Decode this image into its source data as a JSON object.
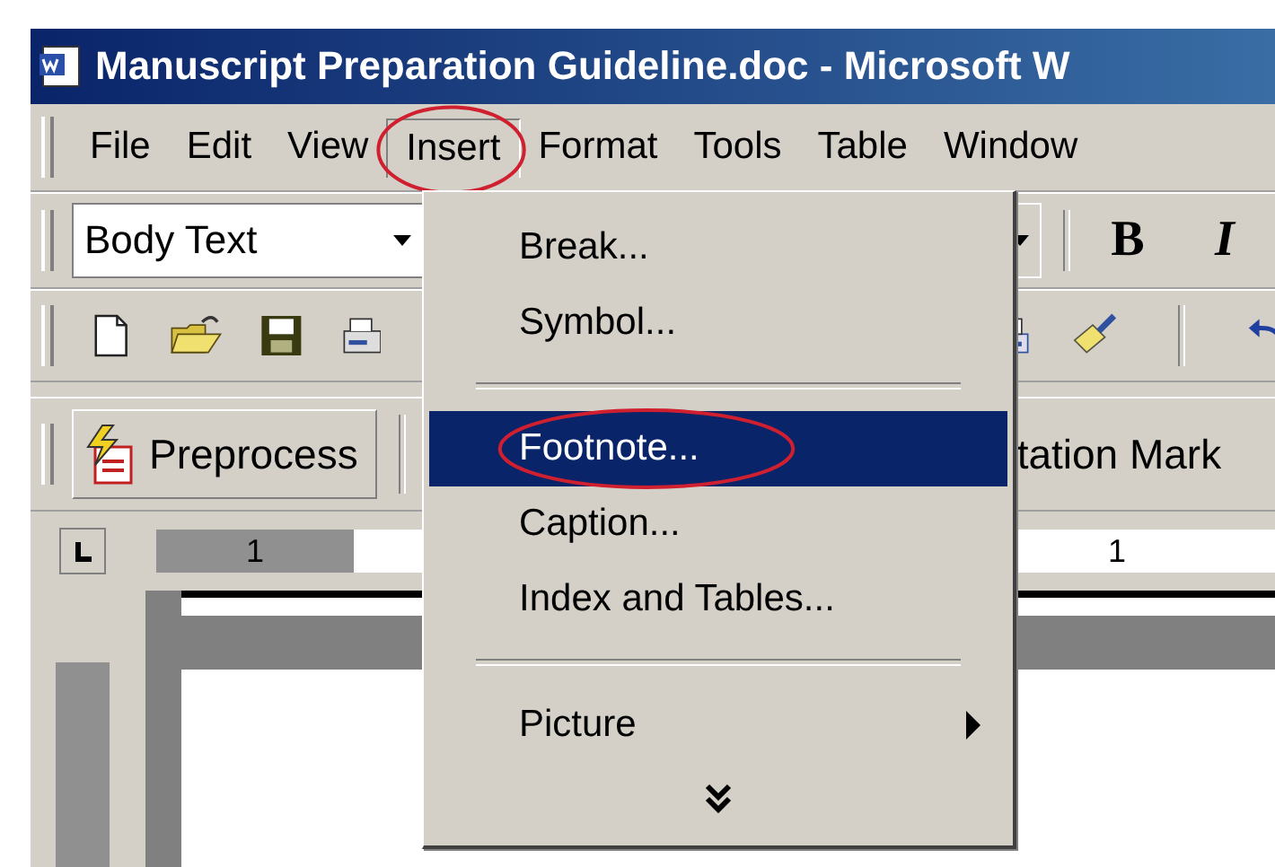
{
  "window": {
    "title": "Manuscript Preparation Guideline.doc - Microsoft W"
  },
  "menu_bar": [
    {
      "label": "File",
      "selected": false,
      "circled": false
    },
    {
      "label": "Edit",
      "selected": false,
      "circled": false
    },
    {
      "label": "View",
      "selected": false,
      "circled": false
    },
    {
      "label": "Insert",
      "selected": true,
      "circled": true
    },
    {
      "label": "Format",
      "selected": false,
      "circled": false
    },
    {
      "label": "Tools",
      "selected": false,
      "circled": false
    },
    {
      "label": "Table",
      "selected": false,
      "circled": false
    },
    {
      "label": "Window",
      "selected": false,
      "circled": false
    }
  ],
  "formatting_toolbar": {
    "style": "Body Text",
    "bold": "B",
    "italic": "I"
  },
  "custom_toolbar": {
    "buttons": [
      "Preprocess",
      "tation Mark"
    ]
  },
  "ruler": {
    "marks": [
      "1",
      "1"
    ]
  },
  "insert_menu": {
    "items": [
      {
        "kind": "item",
        "label": "Break...",
        "selected": false,
        "circled": false
      },
      {
        "kind": "item",
        "label": "Symbol...",
        "selected": false,
        "circled": false
      },
      {
        "kind": "separator"
      },
      {
        "kind": "item",
        "label": "Footnote...",
        "selected": true,
        "circled": true
      },
      {
        "kind": "item",
        "label": "Caption...",
        "selected": false,
        "circled": false
      },
      {
        "kind": "item",
        "label": "Index and Tables...",
        "selected": false,
        "circled": false
      },
      {
        "kind": "separator"
      },
      {
        "kind": "submenu",
        "label": "Picture",
        "selected": false,
        "circled": false
      },
      {
        "kind": "expand"
      }
    ]
  }
}
